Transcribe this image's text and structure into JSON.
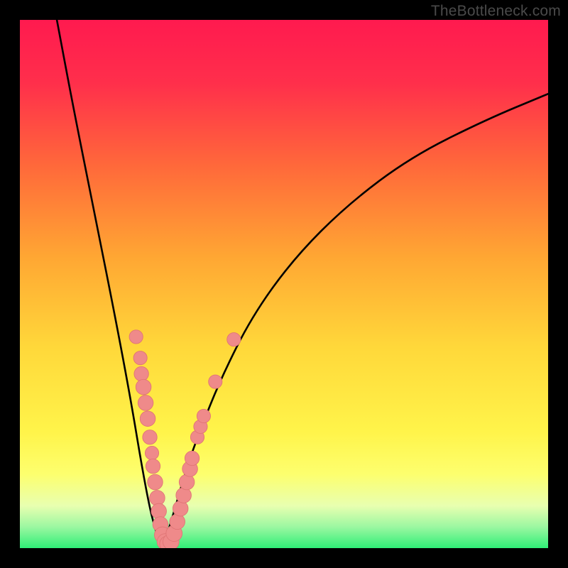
{
  "watermark": "TheBottleneck.com",
  "colors": {
    "frame": "#000000",
    "gradient_stops": [
      {
        "offset": 0.0,
        "color": "#ff1a4f"
      },
      {
        "offset": 0.12,
        "color": "#ff2f4b"
      },
      {
        "offset": 0.28,
        "color": "#ff6a3a"
      },
      {
        "offset": 0.45,
        "color": "#ffa733"
      },
      {
        "offset": 0.62,
        "color": "#ffd83a"
      },
      {
        "offset": 0.78,
        "color": "#fff44a"
      },
      {
        "offset": 0.86,
        "color": "#fdff6e"
      },
      {
        "offset": 0.92,
        "color": "#e8ffb0"
      },
      {
        "offset": 0.96,
        "color": "#9bf7a1"
      },
      {
        "offset": 1.0,
        "color": "#2fef77"
      }
    ],
    "curve": "#000000",
    "marker_fill": "#ef8a8a",
    "marker_stroke": "#e07575"
  },
  "chart_data": {
    "type": "line",
    "title": "",
    "xlabel": "",
    "ylabel": "",
    "xlim": [
      0,
      100
    ],
    "ylim": [
      0,
      100
    ],
    "series": [
      {
        "name": "left-branch",
        "x": [
          7,
          10,
          14,
          18,
          21,
          23,
          24.5,
          25.5,
          26.3,
          27
        ],
        "y": [
          100,
          84,
          64,
          44,
          28,
          16,
          8,
          4,
          1.5,
          0
        ]
      },
      {
        "name": "right-branch",
        "x": [
          27,
          28,
          29.5,
          31.5,
          34,
          38,
          44,
          52,
          62,
          74,
          88,
          100
        ],
        "y": [
          0,
          3,
          8,
          15,
          22,
          32,
          44,
          55,
          65,
          74,
          81,
          86
        ]
      }
    ],
    "markers": [
      {
        "x": 22.0,
        "y": 40.0,
        "r": 3.2
      },
      {
        "x": 22.8,
        "y": 36.0,
        "r": 3.2
      },
      {
        "x": 23.0,
        "y": 33.0,
        "r": 3.4
      },
      {
        "x": 23.4,
        "y": 30.5,
        "r": 3.6
      },
      {
        "x": 23.8,
        "y": 27.5,
        "r": 3.6
      },
      {
        "x": 24.2,
        "y": 24.5,
        "r": 3.6
      },
      {
        "x": 24.6,
        "y": 21.0,
        "r": 3.4
      },
      {
        "x": 25.0,
        "y": 18.0,
        "r": 3.2
      },
      {
        "x": 25.2,
        "y": 15.5,
        "r": 3.4
      },
      {
        "x": 25.6,
        "y": 12.5,
        "r": 3.6
      },
      {
        "x": 26.0,
        "y": 9.5,
        "r": 3.6
      },
      {
        "x": 26.3,
        "y": 7.0,
        "r": 3.6
      },
      {
        "x": 26.6,
        "y": 4.5,
        "r": 3.6
      },
      {
        "x": 27.0,
        "y": 2.5,
        "r": 3.8
      },
      {
        "x": 27.5,
        "y": 1.2,
        "r": 3.8
      },
      {
        "x": 28.0,
        "y": 0.8,
        "r": 3.8
      },
      {
        "x": 28.6,
        "y": 1.2,
        "r": 3.8
      },
      {
        "x": 29.2,
        "y": 2.8,
        "r": 3.8
      },
      {
        "x": 29.8,
        "y": 5.0,
        "r": 3.6
      },
      {
        "x": 30.4,
        "y": 7.5,
        "r": 3.6
      },
      {
        "x": 31.0,
        "y": 10.0,
        "r": 3.6
      },
      {
        "x": 31.6,
        "y": 12.5,
        "r": 3.6
      },
      {
        "x": 32.2,
        "y": 15.0,
        "r": 3.6
      },
      {
        "x": 32.6,
        "y": 17.0,
        "r": 3.4
      },
      {
        "x": 33.6,
        "y": 21.0,
        "r": 3.2
      },
      {
        "x": 34.2,
        "y": 23.0,
        "r": 3.2
      },
      {
        "x": 34.8,
        "y": 25.0,
        "r": 3.2
      },
      {
        "x": 37.0,
        "y": 31.5,
        "r": 3.2
      },
      {
        "x": 40.5,
        "y": 39.5,
        "r": 3.2
      }
    ]
  }
}
